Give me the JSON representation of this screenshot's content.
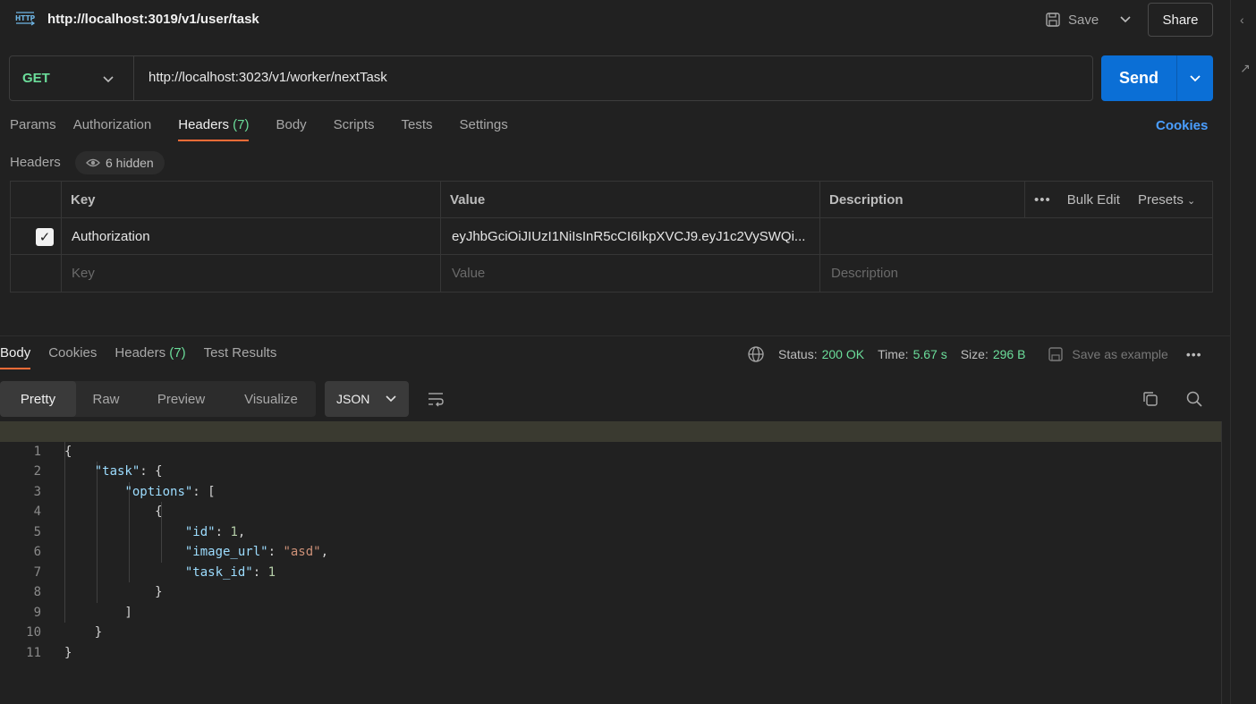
{
  "request": {
    "title": "http://localhost:3019/v1/user/task",
    "save_label": "Save",
    "share_label": "Share",
    "method": "GET",
    "url": "http://localhost:3023/v1/worker/nextTask",
    "send_label": "Send"
  },
  "request_tabs": [
    {
      "label": "Params"
    },
    {
      "label": "Authorization"
    },
    {
      "label": "Headers",
      "count": "(7)"
    },
    {
      "label": "Body"
    },
    {
      "label": "Scripts"
    },
    {
      "label": "Tests"
    },
    {
      "label": "Settings"
    }
  ],
  "cookies_link": "Cookies",
  "headers_section": {
    "label": "Headers",
    "hidden_label": "6 hidden",
    "columns": {
      "key": "Key",
      "value": "Value",
      "description": "Description"
    },
    "bulk_edit": "Bulk Edit",
    "presets": "Presets",
    "rows": [
      {
        "checked": true,
        "key": "Authorization",
        "value": "eyJhbGciOiJIUzI1NiIsInR5cCI6IkpXVCJ9.eyJ1c2VySWQi...",
        "description": ""
      }
    ],
    "placeholders": {
      "key": "Key",
      "value": "Value",
      "description": "Description"
    }
  },
  "response_tabs": [
    {
      "label": "Body"
    },
    {
      "label": "Cookies"
    },
    {
      "label": "Headers",
      "count": "(7)"
    },
    {
      "label": "Test Results"
    }
  ],
  "response_status": {
    "status_label": "Status:",
    "status_value": "200 OK",
    "time_label": "Time:",
    "time_value": "5.67 s",
    "size_label": "Size:",
    "size_value": "296 B",
    "save_example": "Save as example"
  },
  "format_tabs": [
    "Pretty",
    "Raw",
    "Preview",
    "Visualize"
  ],
  "format_selected": "JSON",
  "code_lines": [
    "1",
    "2",
    "3",
    "4",
    "5",
    "6",
    "7",
    "8",
    "9",
    "10",
    "11"
  ],
  "json_body": {
    "task_key": "\"task\"",
    "options_key": "\"options\"",
    "id_key": "\"id\"",
    "id_value": "1",
    "image_url_key": "\"image_url\"",
    "image_url_value": "\"asd\"",
    "task_id_key": "\"task_id\"",
    "task_id_value": "1"
  },
  "colors": {
    "accent_tab": "#ff6c37",
    "send_button": "#0b6fd6",
    "method_get": "#6bdd9a",
    "status_ok": "#6bdd9a",
    "link": "#4a9eff"
  }
}
